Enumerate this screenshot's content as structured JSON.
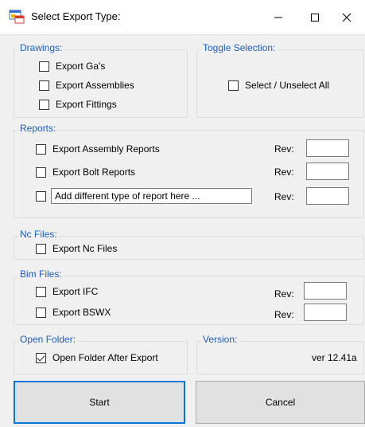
{
  "window": {
    "title": "Select Export Type:"
  },
  "drawings": {
    "legend": "Drawings:",
    "items": [
      {
        "label": "Export Ga's",
        "checked": false
      },
      {
        "label": "Export Assemblies",
        "checked": false
      },
      {
        "label": "Export Fittings",
        "checked": false
      }
    ]
  },
  "toggle": {
    "legend": "Toggle Selection:",
    "label": "Select  / Unselect All",
    "checked": false
  },
  "reports": {
    "legend": "Reports:",
    "items": [
      {
        "label": "Export Assembly Reports",
        "checked": false,
        "rev_label": "Rev:",
        "rev_value": ""
      },
      {
        "label": "Export Bolt Reports",
        "checked": false,
        "rev_label": "Rev:",
        "rev_value": ""
      },
      {
        "label": "Add different type of report here ...",
        "checked": false,
        "rev_label": "Rev:",
        "rev_value": ""
      }
    ]
  },
  "nc": {
    "legend": "Nc Files:",
    "label": "Export Nc Files",
    "checked": false
  },
  "bim": {
    "legend": "Bim Files:",
    "items": [
      {
        "label": "Export IFC",
        "checked": false,
        "rev_label": "Rev:",
        "rev_value": ""
      },
      {
        "label": "Export BSWX",
        "checked": false,
        "rev_label": "Rev:",
        "rev_value": ""
      }
    ]
  },
  "open_folder": {
    "legend": "Open Folder:",
    "label": "Open Folder After Export",
    "checked": true
  },
  "version": {
    "legend": "Version:",
    "value": "ver 12.41a"
  },
  "buttons": {
    "start": "Start",
    "cancel": "Cancel"
  }
}
